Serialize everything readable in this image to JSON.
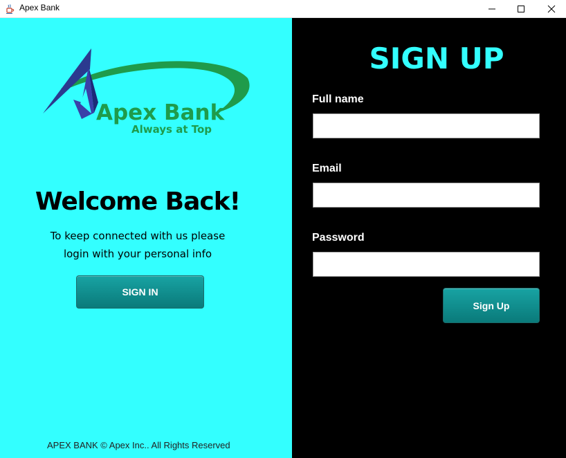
{
  "window": {
    "title": "Apex Bank",
    "app_icon": "java-cup-icon",
    "controls": [
      "minimize-icon",
      "maximize-icon",
      "close-icon"
    ]
  },
  "left_panel": {
    "background": "#33ffff",
    "logo": {
      "name": "Apex Bank",
      "tagline": "Always at Top",
      "text_color": "#1f9b4b",
      "mark_color": "#2b3a8f"
    },
    "heading": "Welcome Back!",
    "info_line_1": "To keep connected with us please",
    "info_line_2": "login with your personal info",
    "signin_label": "SIGN IN",
    "footer": "APEX BANK © Apex Inc.. All Rights Reserved"
  },
  "right_panel": {
    "background": "#000000",
    "title": "SIGN UP",
    "title_color": "#33ffff",
    "fields": [
      {
        "label": "Full name",
        "value": ""
      },
      {
        "label": "Email",
        "value": ""
      },
      {
        "label": "Password",
        "value": ""
      }
    ],
    "signup_label": "Sign Up",
    "button_color": "#0f8f8f"
  }
}
